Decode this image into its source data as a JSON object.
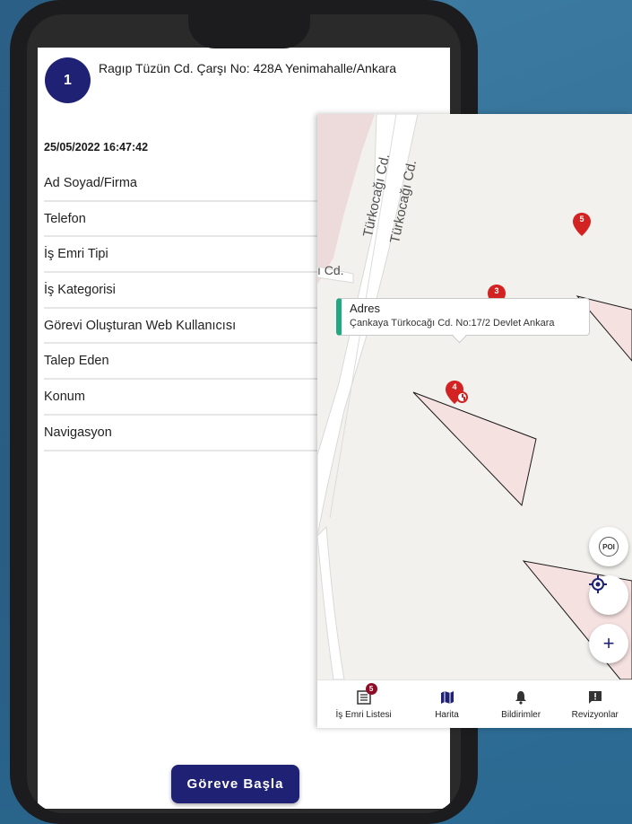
{
  "order": {
    "number": "1",
    "address": "Ragıp Tüzün Cd. Çarşı No: 428A Yenimahalle/Ankara",
    "datetime": "25/05/2022 16:47:42",
    "fields": [
      "Ad Soyad/Firma",
      "Telefon",
      "İş Emri Tipi",
      "İş Kategorisi",
      "Görevi Oluşturan Web Kullanıcısı",
      "Talep Eden",
      "Konum",
      "Navigasyon"
    ],
    "start_button_label": "Göreve Başla"
  },
  "map": {
    "streets": [
      "Türkocağı Cd.",
      "Türkocağı Cd.",
      "ı Cd."
    ],
    "markers": [
      "5",
      "3",
      "4"
    ],
    "popup": {
      "title": "Adres",
      "text": "Çankaya Türkocağı Cd. No:17/2 Devlet Ankara",
      "accent_color": "#22a883"
    },
    "fabs": {
      "poi_label": "POI",
      "locate_icon": "crosshair-icon",
      "zoom_in_label": "+"
    }
  },
  "bottom_nav": {
    "items": [
      {
        "label": "İş Emri Listesi",
        "icon": "list-icon",
        "badge": "5"
      },
      {
        "label": "Harita",
        "icon": "map-icon"
      },
      {
        "label": "Bildirimler",
        "icon": "bell-icon"
      },
      {
        "label": "Revizyonlar",
        "icon": "feedback-icon"
      }
    ]
  },
  "colors": {
    "primary": "#1f2175",
    "marker_red": "#d32222",
    "badge": "#8e0c25"
  }
}
